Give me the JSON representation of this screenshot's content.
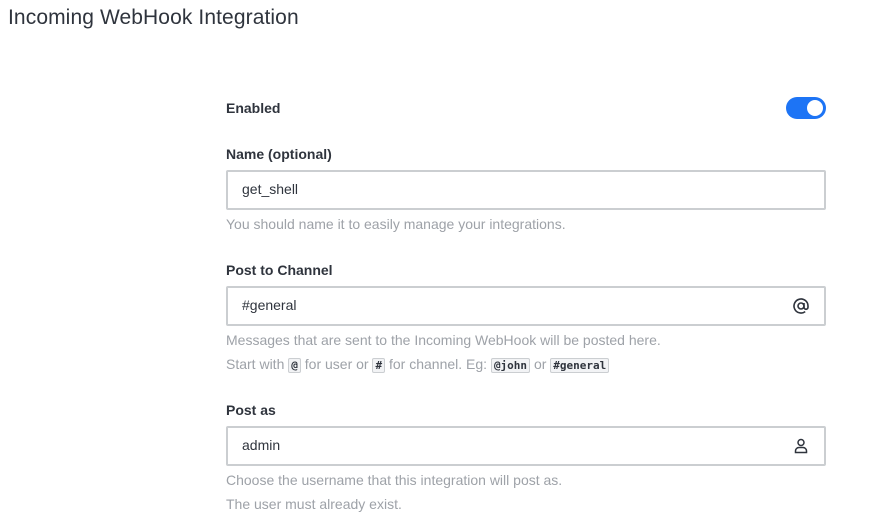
{
  "page": {
    "title": "Incoming WebHook Integration"
  },
  "form": {
    "enabled": {
      "label": "Enabled",
      "on": true,
      "accent_color": "#1d74f5"
    },
    "name": {
      "label": "Name (optional)",
      "value": "get_shell",
      "hint": "You should name it to easily manage your integrations."
    },
    "channel": {
      "label": "Post to Channel",
      "value": "#general",
      "addon_icon": "at-icon",
      "hint_line1": "Messages that are sent to the Incoming WebHook will be posted here.",
      "hint_line2": {
        "prefix": "Start with",
        "code1": "@",
        "mid1": "for user or",
        "code2": "#",
        "mid2": "for channel. Eg:",
        "code3": "@john",
        "mid3": "or",
        "code4": "#general"
      }
    },
    "post_as": {
      "label": "Post as",
      "value": "admin",
      "addon_icon": "user-icon",
      "hint_line1": "Choose the username that this integration will post as.",
      "hint_line2": "The user must already exist."
    }
  }
}
